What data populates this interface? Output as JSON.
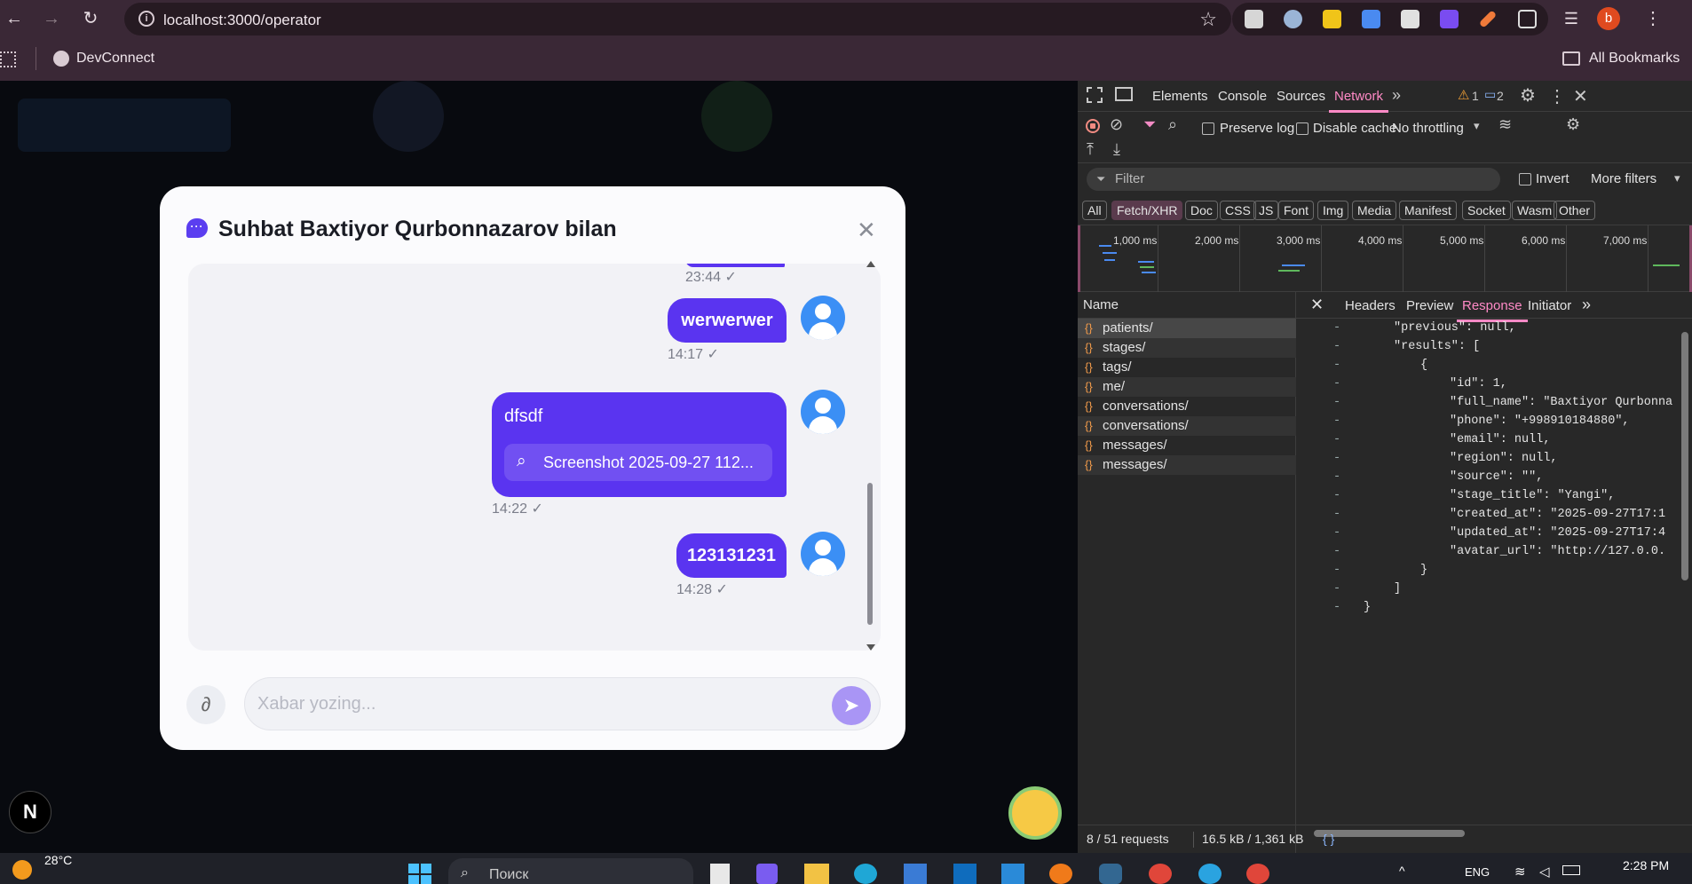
{
  "browser": {
    "url": "localhost:3000/operator",
    "bookmark": "DevConnect",
    "all_bookmarks": "All Bookmarks",
    "profile_initial": "b"
  },
  "modal": {
    "title": "Suhbat Baxtiyor Qurbonnazarov bilan",
    "messages": [
      {
        "text": "",
        "time": "23:44 ✓"
      },
      {
        "text": "werwerwer",
        "time": "14:17 ✓"
      },
      {
        "text": "dfsdf",
        "attachment": "Screenshot 2025-09-27 112...",
        "time": "14:22 ✓"
      },
      {
        "text": "123131231",
        "time": "14:28 ✓"
      }
    ],
    "input_placeholder": "Xabar yozing..."
  },
  "devtools": {
    "tabs": [
      "Elements",
      "Console",
      "Sources",
      "Network"
    ],
    "active_tab": "Network",
    "warnings": "1",
    "messages": "2",
    "preserve_log": "Preserve log",
    "disable_cache": "Disable cache",
    "throttling": "No throttling",
    "filter_placeholder": "Filter",
    "invert": "Invert",
    "more_filters": "More filters",
    "type_filters": [
      "All",
      "Fetch/XHR",
      "Doc",
      "CSS",
      "JS",
      "Font",
      "Img",
      "Media",
      "Manifest",
      "Socket",
      "Wasm",
      "Other"
    ],
    "active_type_filter": "Fetch/XHR",
    "timeline_ticks": [
      "1,000 ms",
      "2,000 ms",
      "3,000 ms",
      "4,000 ms",
      "5,000 ms",
      "6,000 ms",
      "7,000 ms"
    ],
    "name_header": "Name",
    "requests": [
      "patients/",
      "stages/",
      "tags/",
      "me/",
      "conversations/",
      "conversations/",
      "messages/",
      "messages/"
    ],
    "detail_tabs": [
      "Headers",
      "Preview",
      "Response",
      "Initiator"
    ],
    "active_detail_tab": "Response",
    "response_lines": [
      "\"previous\": null,",
      "\"results\": [",
      "{",
      "\"id\": 1,",
      "\"full_name\": \"Baxtiyor Qurbonna",
      "\"phone\": \"+998910184880\",",
      "\"email\": null,",
      "\"region\": null,",
      "\"source\": \"\",",
      "\"stage_title\": \"Yangi\",",
      "\"created_at\": \"2025-09-27T17:1",
      "\"updated_at\": \"2025-09-27T17:4",
      "\"avatar_url\": \"http://127.0.0.",
      "}",
      "]",
      "}"
    ],
    "status_requests": "8 / 51 requests",
    "status_size": "16.5 kB / 1,361 kB"
  },
  "taskbar": {
    "weather": "28°C",
    "search": "Поиск",
    "lang": "ENG",
    "clock": "2:28 PM"
  }
}
